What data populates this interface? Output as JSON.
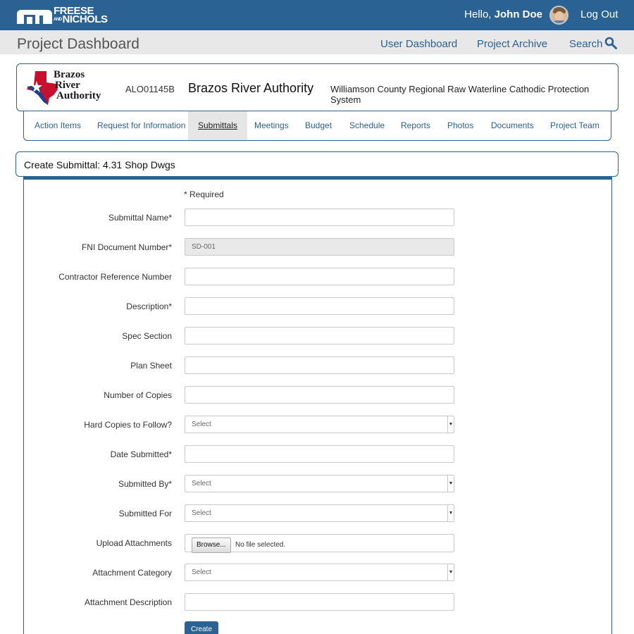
{
  "brand": {
    "line1": "FREESE",
    "and": "AND",
    "line2": "NICHOLS",
    "colors": {
      "primary": "#2a6294",
      "subheader": "#e8e8e8",
      "tab_active": "#e6e6e6"
    }
  },
  "header": {
    "greeting": "Hello,",
    "user_name": "John Doe",
    "logout_label": "Log Out"
  },
  "subheader": {
    "title": "Project Dashboard",
    "links": [
      "User Dashboard",
      "Project Archive",
      "Search"
    ],
    "search_icon": "search-icon"
  },
  "project": {
    "client_logo_lines": [
      "Brazos",
      "River",
      "Authority"
    ],
    "code": "ALO01145B",
    "client": "Brazos River Authority",
    "description": "Williamson County Regional Raw Waterline Cathodic Protection System"
  },
  "tabs": {
    "items": [
      "Action Items",
      "Request for Information",
      "Submittals",
      "Meetings",
      "Budget",
      "Schedule",
      "Reports",
      "Photos",
      "Documents",
      "Project Team"
    ],
    "active": "Submittals"
  },
  "form": {
    "title": "Create Submittal: 4.31 Shop Dwgs",
    "required_note": "* Required",
    "fields": {
      "submittal_name": {
        "label": "Submittal Name*",
        "value": ""
      },
      "fni_document_number": {
        "label": "FNI Document Number*",
        "value": "SD-001"
      },
      "contractor_reference_number": {
        "label": "Contractor Reference Number",
        "value": ""
      },
      "description": {
        "label": "Description*",
        "value": ""
      },
      "spec_section": {
        "label": "Spec Section",
        "value": ""
      },
      "plan_sheet": {
        "label": "Plan Sheet",
        "value": ""
      },
      "number_of_copies": {
        "label": "Number of Copies",
        "value": ""
      },
      "hard_copies_to_follow": {
        "label": "Hard Copies to Follow?",
        "value": "Select"
      },
      "date_submitted": {
        "label": "Date Submitted*",
        "value": ""
      },
      "submitted_by": {
        "label": "Submitted By*",
        "value": "Select"
      },
      "submitted_for": {
        "label": "Submitted For",
        "value": "Select"
      },
      "upload_attachments": {
        "label": "Upload Attachments",
        "button": "Browse...",
        "status": "No file selected."
      },
      "attachment_category": {
        "label": "Attachment Category",
        "value": "Select"
      },
      "attachment_description": {
        "label": "Attachment Description",
        "value": ""
      }
    },
    "create_label": "Create"
  }
}
